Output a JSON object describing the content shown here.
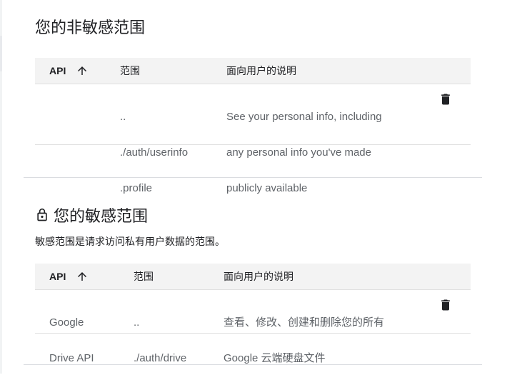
{
  "non_sensitive": {
    "title": "您的非敏感范围",
    "headers": {
      "api": "API",
      "scope": "范围",
      "user_desc": "面向用户的说明"
    },
    "rows": [
      {
        "api": "",
        "scope_line1": "..",
        "scope_line2": "./auth/userinfo",
        "scope_line3": ".profile",
        "desc_line1": "See your personal info, including",
        "desc_line2": "any personal info you've made",
        "desc_line3": "publicly available"
      }
    ]
  },
  "sensitive": {
    "title": "您的敏感范围",
    "description": "敏感范围是请求访问私有用户数据的范围。",
    "headers": {
      "api": "API",
      "scope": "范围",
      "user_desc": "面向用户的说明"
    },
    "rows": [
      {
        "api_line1": "Google",
        "api_line2": "Drive API",
        "scope_line1": "..",
        "scope_line2": "./auth/drive",
        "desc_line1": "查看、修改、创建和删除您的所有",
        "desc_line2": "Google 云端硬盘文件"
      }
    ]
  },
  "icons": {
    "sort": "arrow-upward-icon",
    "delete": "trash-icon",
    "lock": "lock-icon"
  },
  "colors": {
    "header_bg": "#f3f3f3",
    "text_primary": "#202124",
    "text_secondary": "#5f6368",
    "divider": "#dadce0"
  }
}
